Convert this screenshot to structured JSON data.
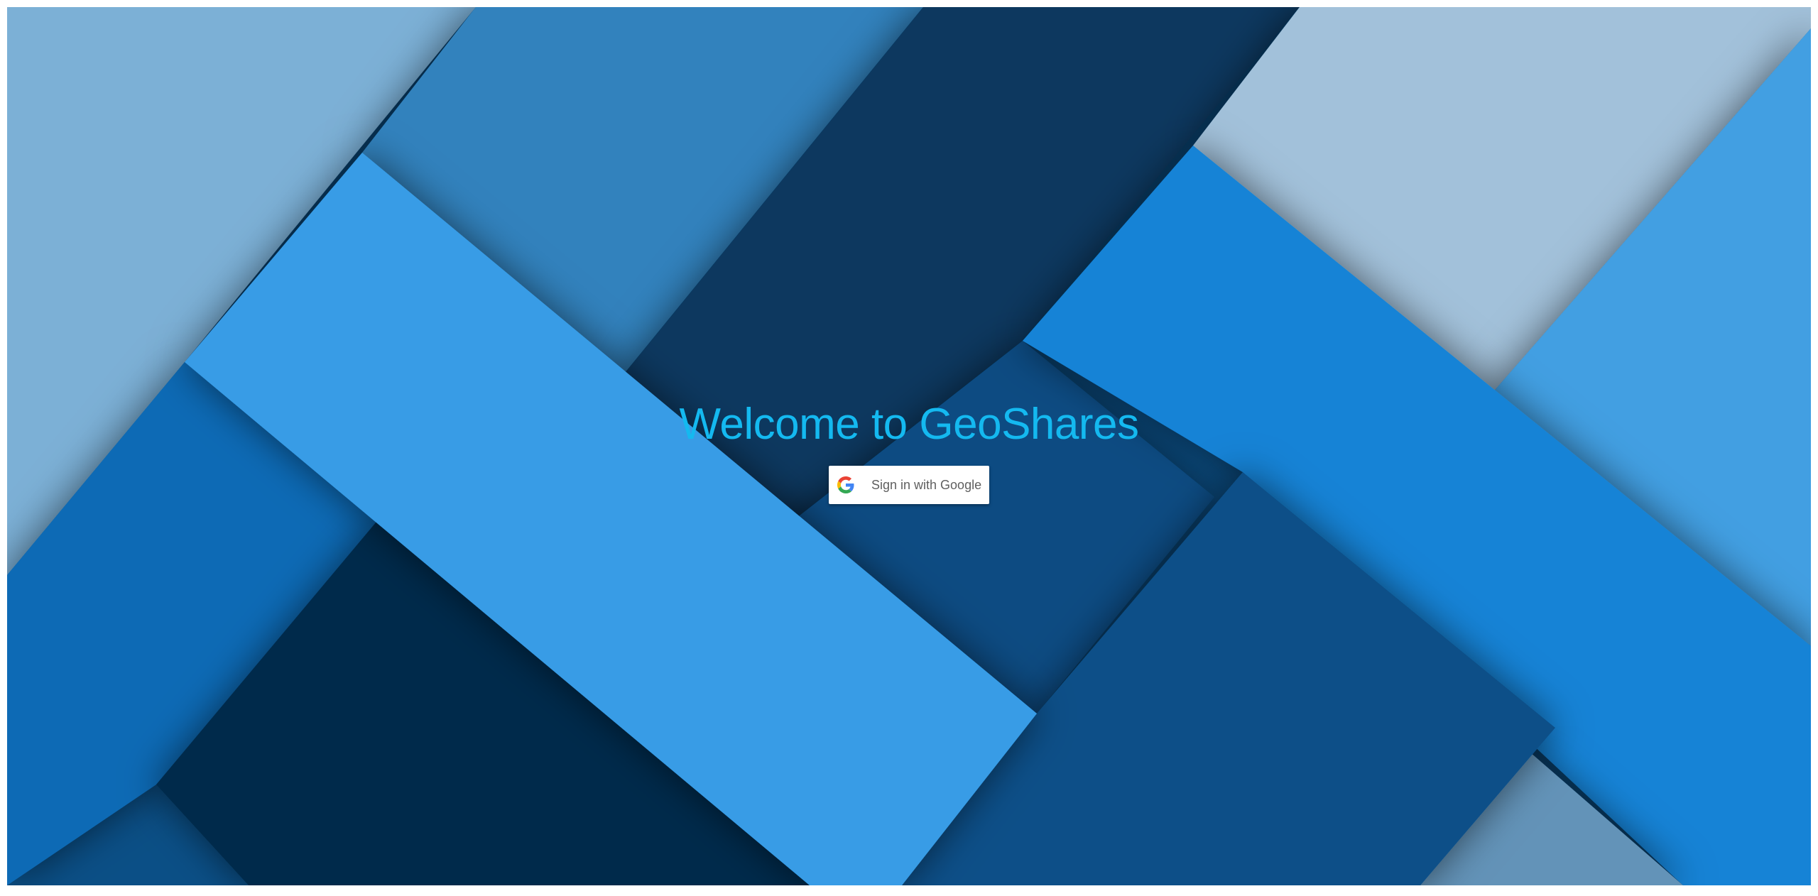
{
  "page": {
    "title": "Welcome to GeoShares"
  },
  "signin": {
    "label": "Sign in with Google",
    "icon": "google-g-icon"
  },
  "colors": {
    "title": "#14b9f0",
    "button_bg": "#ffffff",
    "button_text": "#5f5f5f",
    "background_base": "#0a4a80"
  }
}
